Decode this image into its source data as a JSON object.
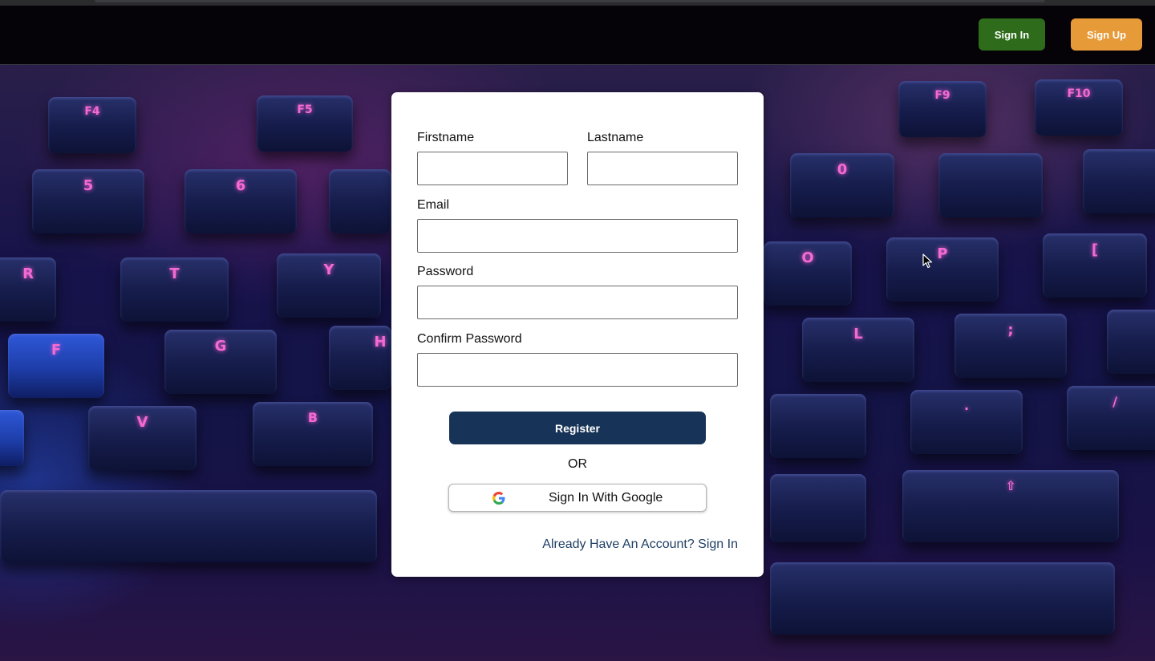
{
  "nav": {
    "signin_label": "Sign In",
    "signup_label": "Sign Up",
    "signin_color": "#2e6b1a",
    "signup_color": "#e79a38"
  },
  "form": {
    "firstname_label": "Firstname",
    "firstname_value": "",
    "lastname_label": "Lastname",
    "lastname_value": "",
    "email_label": "Email",
    "email_value": "",
    "password_label": "Password",
    "password_value": "",
    "confirm_password_label": "Confirm Password",
    "confirm_password_value": "",
    "register_label": "Register",
    "or_label": "OR",
    "google_label": "Sign In With Google",
    "google_icon": "google-g-icon",
    "signin_link_label": "Already Have An Account? Sign In",
    "register_color": "#173357",
    "link_color": "#1f3f64"
  },
  "background": {
    "description_icon": "keyboard-photo",
    "keys": [
      "F4",
      "F5",
      "5",
      "6",
      "R",
      "T",
      "Y",
      "F",
      "G",
      "H",
      "V",
      "B",
      "F9",
      "F10",
      "0",
      "O",
      "P",
      "[",
      "L",
      ";",
      ".",
      "/",
      "⇧"
    ]
  }
}
